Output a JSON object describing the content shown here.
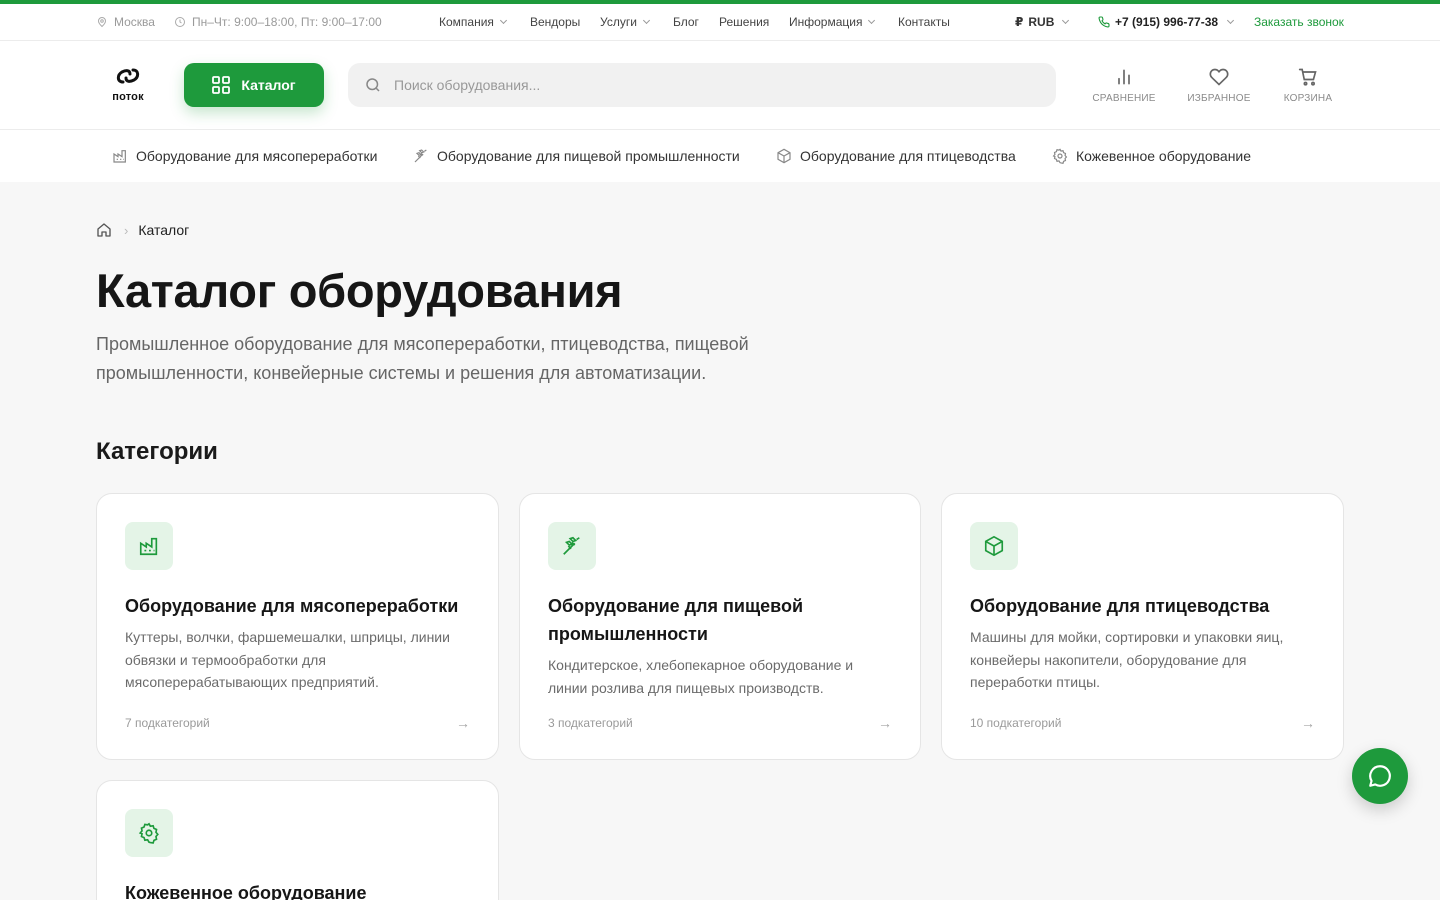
{
  "topbar": {
    "city": "Москва",
    "hours": "Пн–Чт: 9:00–18:00, Пт: 9:00–17:00",
    "nav": [
      "Компания",
      "Вендоры",
      "Услуги",
      "Блог",
      "Решения",
      "Информация",
      "Контакты"
    ],
    "currency": "RUB",
    "currency_symbol": "₽",
    "phone": "+7 (915) 996-77-38",
    "callback": "Заказать звонок"
  },
  "header": {
    "logo_text": "поток",
    "catalog_label": "Каталог",
    "search_placeholder": "Поиск оборудования...",
    "compare_label": "СРАВНЕНИЕ",
    "favorites_label": "ИЗБРАННОЕ",
    "cart_label": "КОРЗИНА"
  },
  "subnav": [
    {
      "label": "Оборудование для мясопереработки",
      "icon": "factory-icon"
    },
    {
      "label": "Оборудование для пищевой промышленности",
      "icon": "wheat-icon"
    },
    {
      "label": "Оборудование для птицеводства",
      "icon": "box-icon"
    },
    {
      "label": "Кожевенное оборудование",
      "icon": "gear-icon"
    }
  ],
  "breadcrumb": {
    "current": "Каталог"
  },
  "page": {
    "title": "Каталог оборудования",
    "lead": "Промышленное оборудование для мясопереработки, птицеводства, пищевой промышленности, конвейерные системы и решения для автоматизации.",
    "categories_heading": "Категории"
  },
  "categories": [
    {
      "title": "Оборудование для мясопереработки",
      "desc": "Куттеры, волчки, фаршемешалки, шприцы, линии обвязки и термообработки для мясоперерабатывающих предприятий.",
      "count": "7 подкатегорий",
      "icon": "factory-icon"
    },
    {
      "title": "Оборудование для пищевой промышленности",
      "desc": "Кондитерское, хлебопекарное оборудование и линии розлива для пищевых производств.",
      "count": "3 подкатегорий",
      "icon": "wheat-icon"
    },
    {
      "title": "Оборудование для птицеводства",
      "desc": "Машины для мойки, сортировки и упаковки яиц, конвейеры накопители, оборудование для переработки птицы.",
      "count": "10 подкатегорий",
      "icon": "box-icon"
    },
    {
      "title": "Кожевенное оборудование",
      "icon": "gear-icon"
    }
  ],
  "colors": {
    "brand": "#1e9a3c",
    "brand_light": "#e4f4e7"
  }
}
